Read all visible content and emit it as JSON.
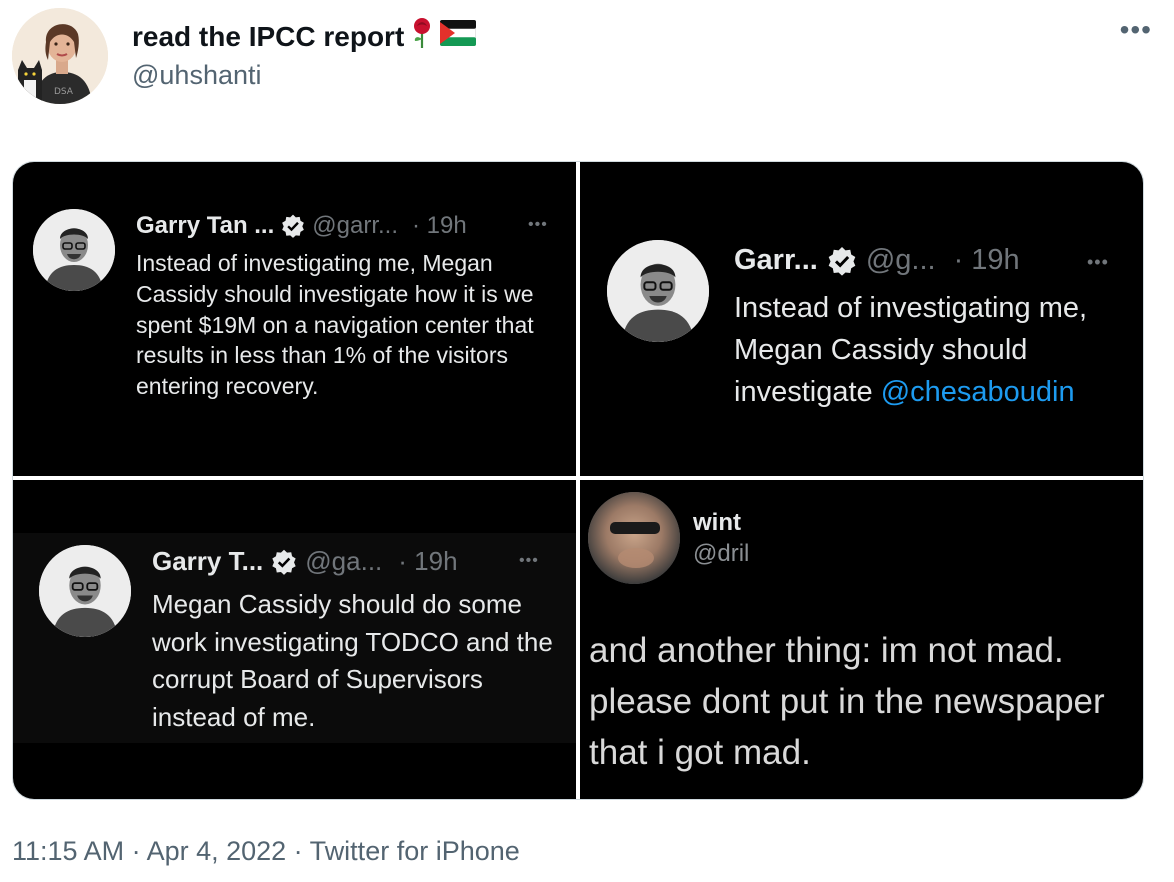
{
  "tweet": {
    "display_name": "read the IPCC report",
    "handle": "@uhshanti",
    "more_label": "•••",
    "meta": "11:15 AM · Apr 4, 2022 · Twitter for iPhone"
  },
  "screenshots": {
    "top_left": {
      "name": "Garry Tan ...",
      "handle": "@garr...",
      "time": "· 19h",
      "more": "•••",
      "text": "Instead of investigating me, Megan Cassidy should investigate how it is we spent $19M on a navigation center that results in less than 1% of the visitors entering recovery."
    },
    "top_right": {
      "name": "Garr...",
      "handle": "@g...",
      "time": "· 19h",
      "more": "•••",
      "text": "Instead of investigating me, Megan Cassidy should investigate",
      "mention": "@chesaboudin"
    },
    "bottom_left": {
      "name": "Garry T...",
      "handle": "@ga...",
      "time": "· 19h",
      "more": "•••",
      "text": "Megan Cassidy should do some work investigating TODCO and the corrupt Board of Supervisors instead of me."
    },
    "bottom_right": {
      "name": "wint",
      "handle": "@dril",
      "line1": "and another thing: im not mad.",
      "line2": "please dont put in the newspaper",
      "line3": "that i got mad."
    }
  },
  "colors": {
    "tweet_text": "#0f1419",
    "secondary": "#536471",
    "dark_bg": "#000000",
    "link_blue": "#1d9bf0"
  }
}
